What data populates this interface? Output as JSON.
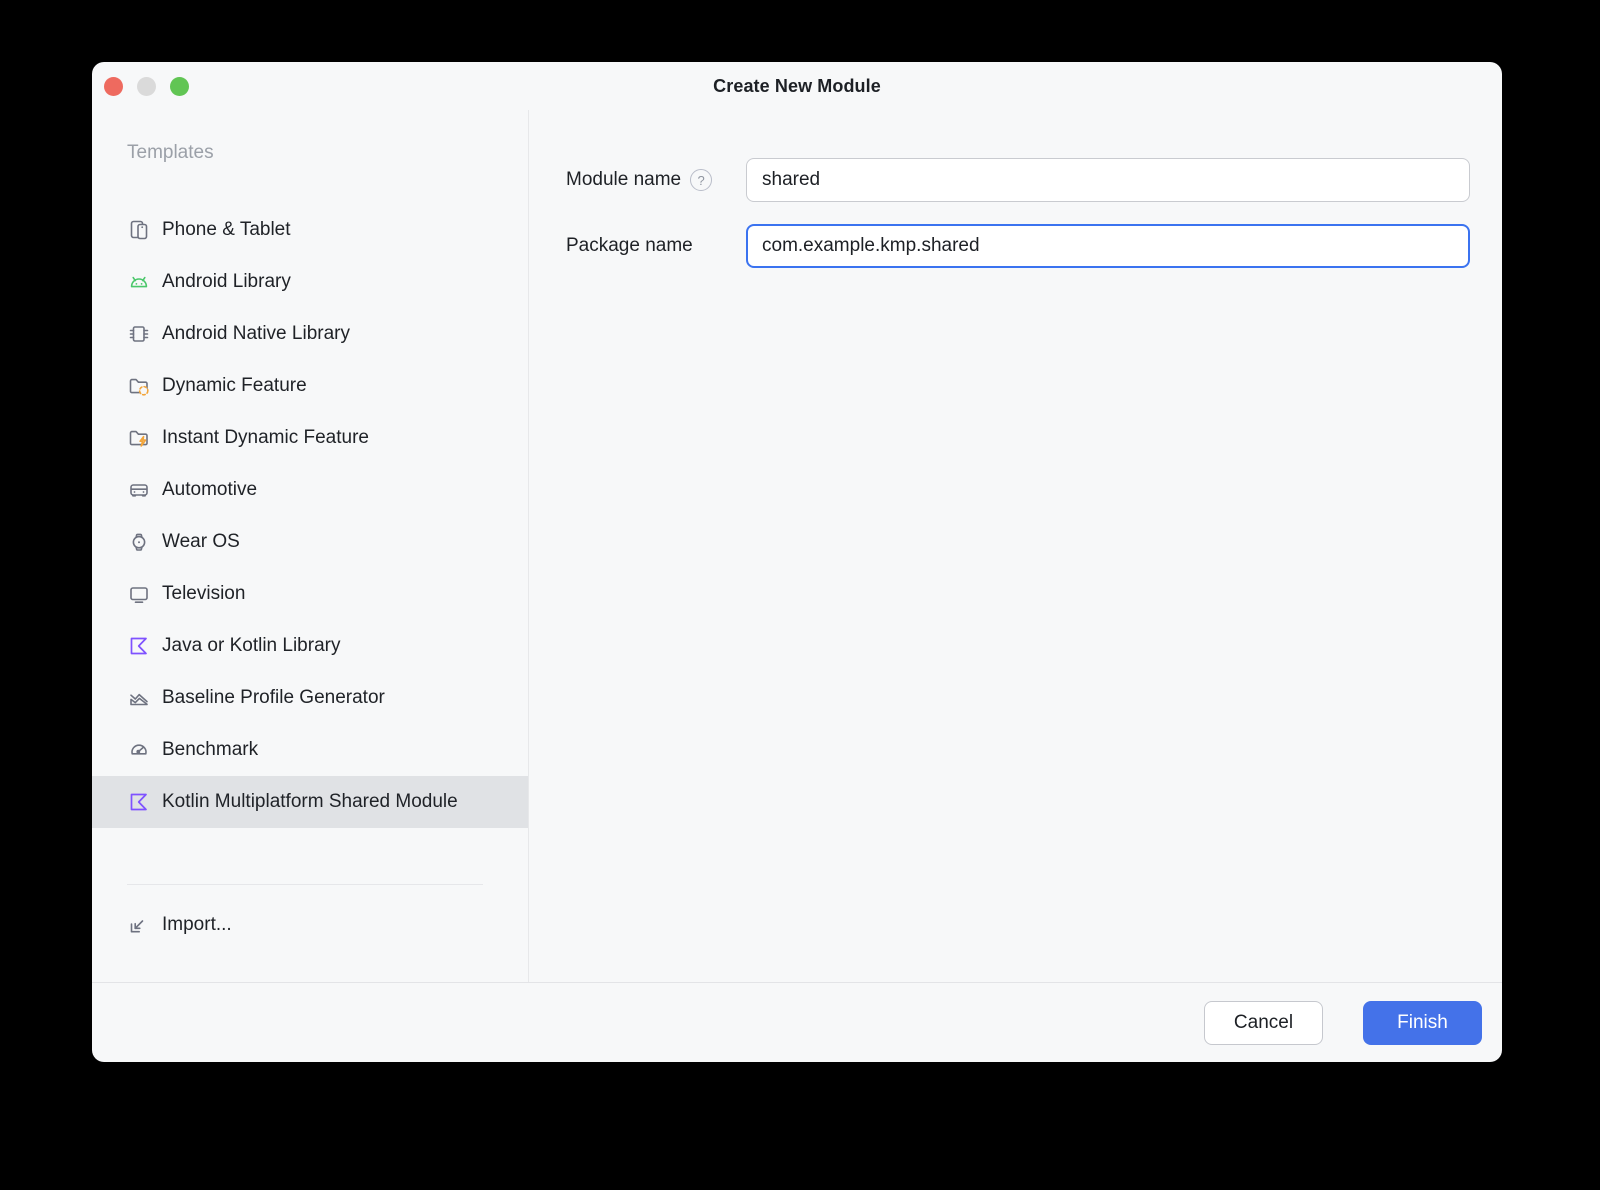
{
  "window": {
    "title": "Create New Module",
    "traffic_lights": {
      "close": "#ee6a5f",
      "minimize": "#dadada",
      "zoom": "#61c554"
    }
  },
  "sidebar": {
    "header": "Templates",
    "items": [
      {
        "label": "Phone & Tablet",
        "icon": "phone-tablet",
        "selected": false
      },
      {
        "label": "Android Library",
        "icon": "android",
        "selected": false
      },
      {
        "label": "Android Native Library",
        "icon": "chip",
        "selected": false
      },
      {
        "label": "Dynamic Feature",
        "icon": "folder-dynamic",
        "selected": false
      },
      {
        "label": "Instant Dynamic Feature",
        "icon": "folder-instant",
        "selected": false
      },
      {
        "label": "Automotive",
        "icon": "car",
        "selected": false
      },
      {
        "label": "Wear OS",
        "icon": "watch",
        "selected": false
      },
      {
        "label": "Television",
        "icon": "tv",
        "selected": false
      },
      {
        "label": "Java or Kotlin Library",
        "icon": "kotlin",
        "selected": false
      },
      {
        "label": "Baseline Profile Generator",
        "icon": "chart",
        "selected": false
      },
      {
        "label": "Benchmark",
        "icon": "gauge",
        "selected": false
      },
      {
        "label": "Kotlin Multiplatform Shared Module",
        "icon": "kotlin",
        "selected": true
      }
    ],
    "import_label": "Import...",
    "import_icon": "import"
  },
  "form": {
    "module_name": {
      "label": "Module name",
      "value": "shared",
      "help": "?"
    },
    "package_name": {
      "label": "Package name",
      "value": "com.example.kmp.shared",
      "focused": true
    }
  },
  "footer": {
    "cancel_label": "Cancel",
    "finish_label": "Finish"
  },
  "colors": {
    "accent_blue": "#4472e9",
    "focus_border_blue": "#3b73f0",
    "kotlin_purple": "#7f52ff",
    "android_green": "#4bc76b",
    "folder_accent_orange": "#f2a53c",
    "selected_row_bg": "#e0e2e5",
    "window_bg": "#f7f8f9"
  }
}
